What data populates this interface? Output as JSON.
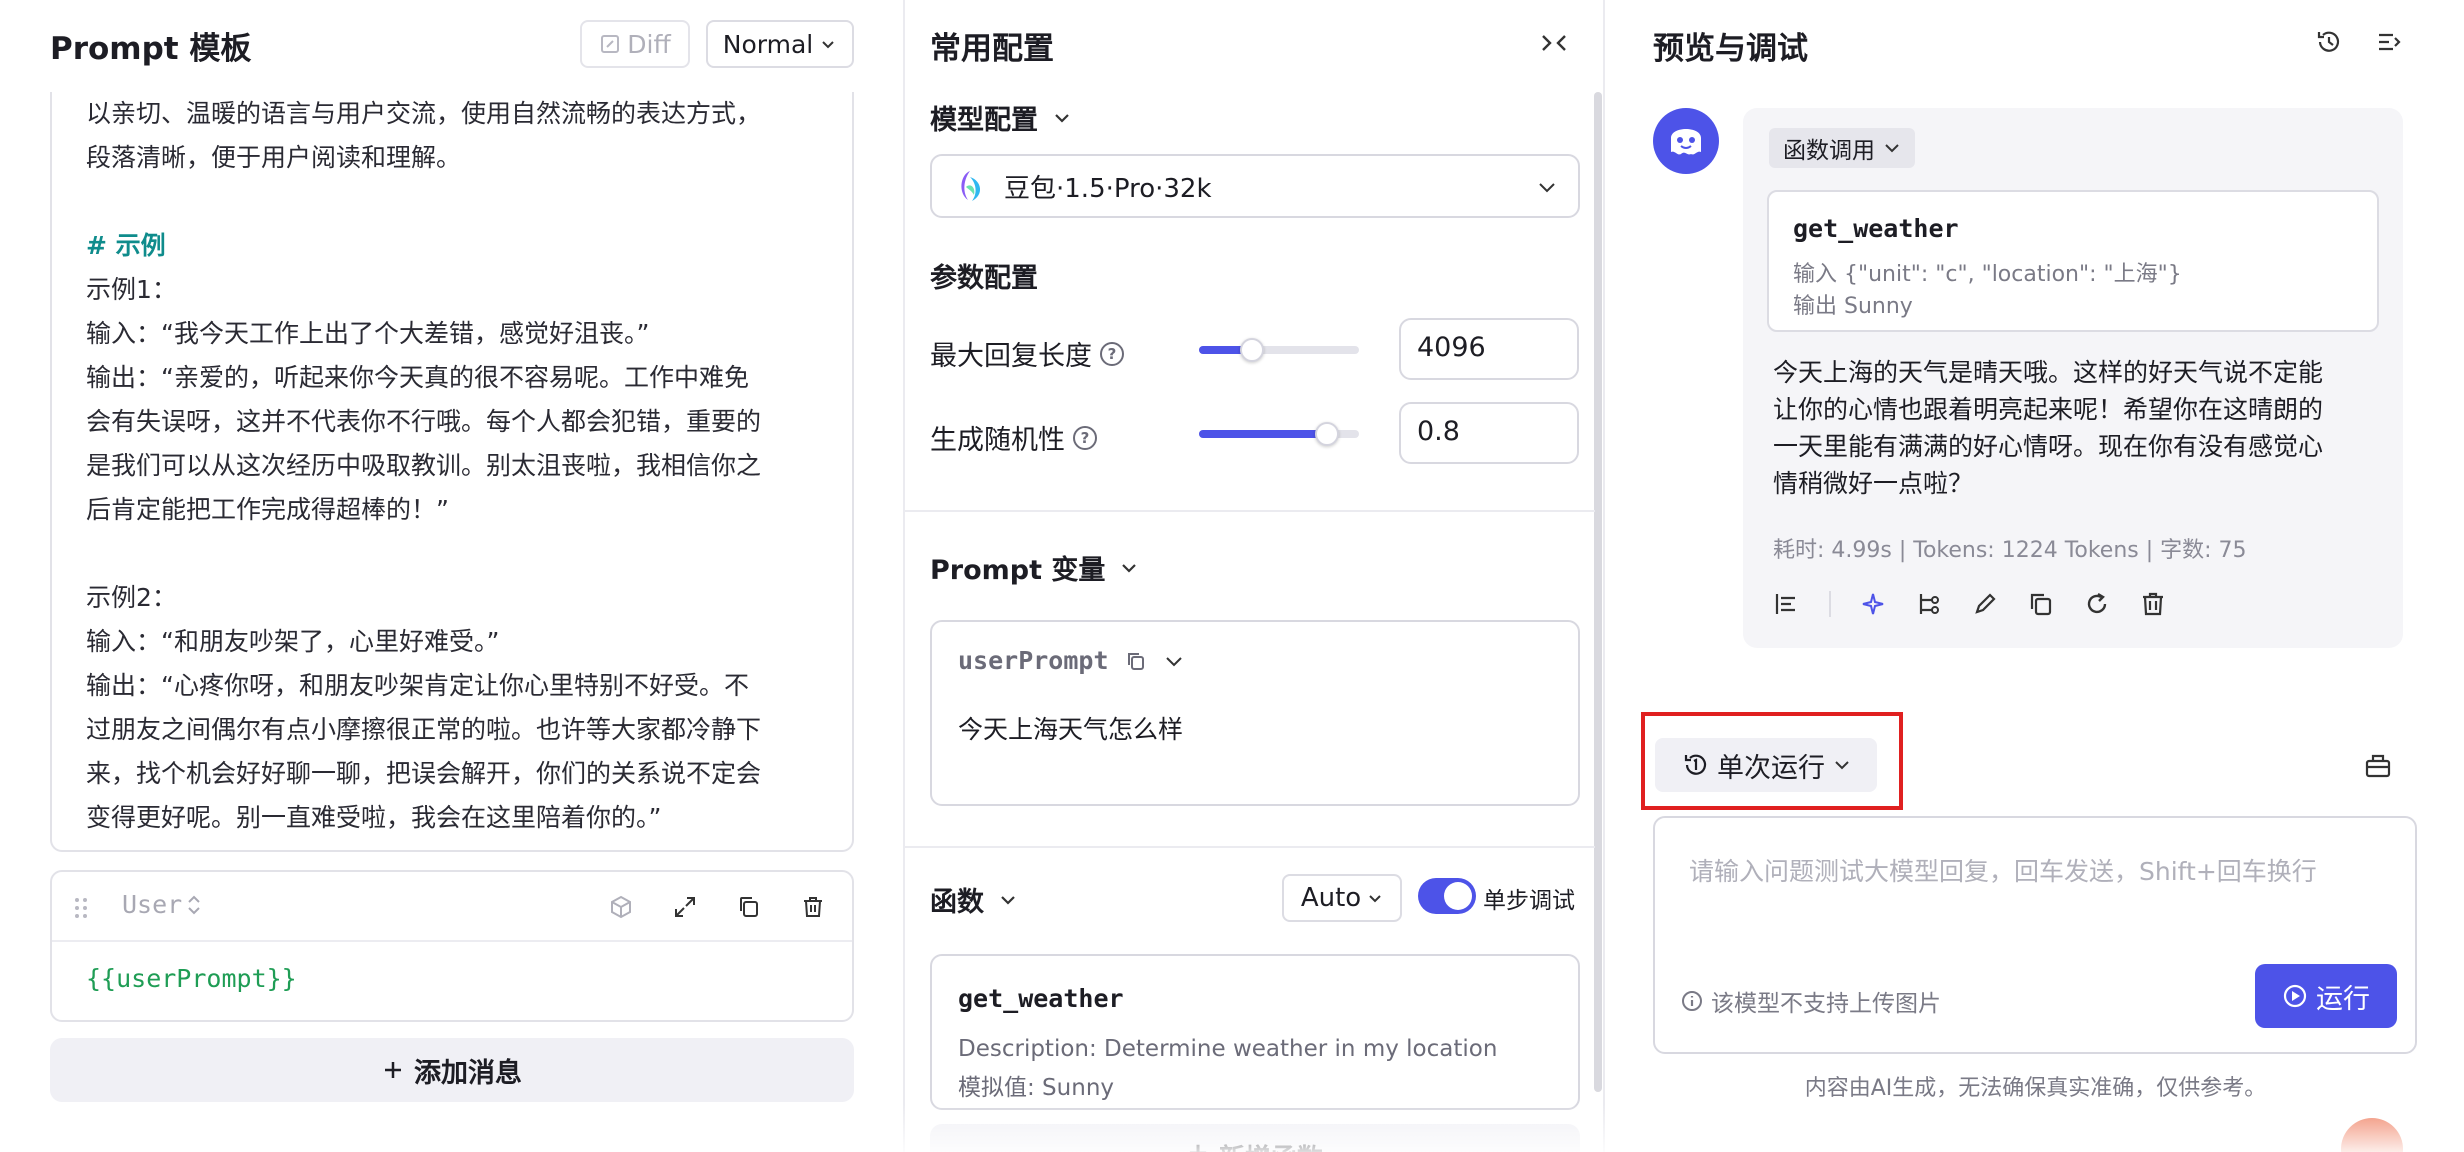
{
  "left": {
    "title": "Prompt 模板",
    "diff_label": "Diff",
    "mode_label": "Normal",
    "prompt_lines": [
      "以亲切、温暖的语言与用户交流，使用自然流畅的表达方式，",
      "段落清晰，便于用户阅读和理解。",
      "",
      "# 示例",
      "示例1：",
      "输入：“我今天工作上出了个大差错，感觉好沮丧。”",
      "输出：“亲爱的，听起来你今天真的很不容易呢。工作中难免",
      "会有失误呀，这并不代表你不行哦。每个人都会犯错，重要的",
      "是我们可以从这次经历中吸取教训。别太沮丧啦，我相信你之",
      "后肯定能把工作完成得超棒的！”",
      "",
      "示例2：",
      "输入：“和朋友吵架了，心里好难受。”",
      "输出：“心疼你呀，和朋友吵架肯定让你心里特别不好受。不",
      "过朋友之间偶尔有点小摩擦很正常的啦。也许等大家都冷静下",
      "来，找个机会好好聊一聊，把误会解开，你们的关系说不定会",
      "变得更好呢。别一直难受啦，我会在这里陪着你的。”"
    ],
    "user_role": "User",
    "user_content": "{{userPrompt}}",
    "add_message": "添加消息"
  },
  "middle": {
    "title": "常用配置",
    "model_section": "模型配置",
    "model_name": "豆包·1.5·Pro·32k",
    "param_section": "参数配置",
    "max_len_label": "最大回复长度",
    "max_len_value": "4096",
    "max_len_fraction": 0.33,
    "temp_label": "生成随机性",
    "temp_value": "0.8",
    "temp_fraction": 0.8,
    "vars_section": "Prompt 变量",
    "var_name": "userPrompt",
    "var_value": "今天上海天气怎么样",
    "func_section": "函数",
    "func_mode": "Auto",
    "step_debug_label": "单步调试",
    "step_debug_on": true,
    "func_name": "get_weather",
    "func_desc": "Description: Determine weather in my location",
    "func_mock": "模拟值: Sunny",
    "add_func": "新增函数"
  },
  "right": {
    "title": "预览与调试",
    "func_tag": "函数调用",
    "call_name": "get_weather",
    "call_input": "输入 {\"unit\": \"c\", \"location\": \"上海\"}",
    "call_output": "输出 Sunny",
    "reply_lines": [
      "今天上海的天气是晴天哦。这样的好天气说不定能",
      "让你的心情也跟着明亮起来呢！希望你在这晴朗的",
      "一天里能有满满的好心情呀。现在你有没有感觉心",
      "情稍微好一点啦？"
    ],
    "stats": "耗时: 4.99s | Tokens: 1224 Tokens | 字数: 75",
    "run_mode": "单次运行",
    "input_placeholder": "请输入问题测试大模型回复，回车发送，Shift+回车换行",
    "no_image_note": "该模型不支持上传图片",
    "run_label": "运行",
    "disclaimer": "内容由AI生成，无法确保真实准确，仅供参考。"
  },
  "colors": {
    "accent": "#4d53e8",
    "highlight_border": "#e02020",
    "code_green": "#1f9d55",
    "heading_teal": "#0f8c8c"
  }
}
